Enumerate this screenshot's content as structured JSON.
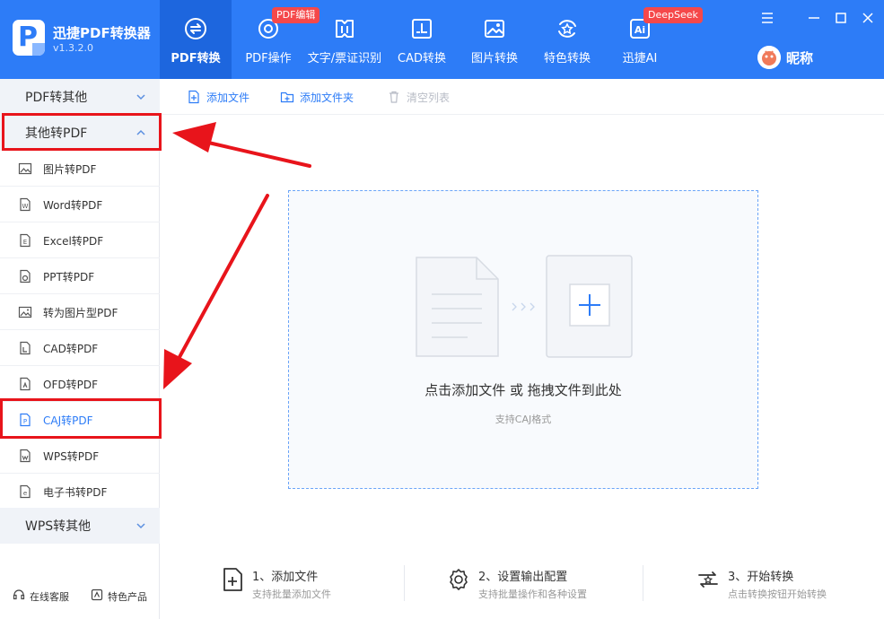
{
  "app": {
    "name": "迅捷PDF转换器",
    "version": "v1.3.2.0"
  },
  "nav_tabs": [
    {
      "label": "PDF转换",
      "active": true,
      "icon": "convert-icon"
    },
    {
      "label": "PDF操作",
      "icon": "gear-doc-icon",
      "badge": "PDF编辑"
    },
    {
      "label": "文字/票证识别",
      "icon": "scan-text-icon"
    },
    {
      "label": "CAD转换",
      "icon": "cad-icon"
    },
    {
      "label": "图片转换",
      "icon": "image-icon"
    },
    {
      "label": "特色转换",
      "icon": "star-convert-icon"
    },
    {
      "label": "迅捷AI",
      "icon": "ai-icon",
      "badge": "DeepSeek"
    }
  ],
  "user": {
    "nickname": "昵称"
  },
  "sidebar": {
    "groups": {
      "pdf_to_other": "PDF转其他",
      "other_to_pdf": "其他转PDF",
      "wps_to_other": "WPS转其他"
    },
    "items": [
      {
        "label": "图片转PDF",
        "icon": "image-icon"
      },
      {
        "label": "Word转PDF",
        "icon": "word-icon"
      },
      {
        "label": "Excel转PDF",
        "icon": "excel-icon"
      },
      {
        "label": "PPT转PDF",
        "icon": "ppt-icon"
      },
      {
        "label": "转为图片型PDF",
        "icon": "image-pdf-icon"
      },
      {
        "label": "CAD转PDF",
        "icon": "cad-icon"
      },
      {
        "label": "OFD转PDF",
        "icon": "ofd-icon"
      },
      {
        "label": "CAJ转PDF",
        "icon": "caj-icon",
        "active": true
      },
      {
        "label": "WPS转PDF",
        "icon": "wps-icon"
      },
      {
        "label": "电子书转PDF",
        "icon": "ebook-icon"
      }
    ],
    "footer": {
      "service": "在线客服",
      "featured": "特色产品"
    }
  },
  "toolbar": {
    "add_file": "添加文件",
    "add_folder": "添加文件夹",
    "clear_list": "清空列表"
  },
  "dropzone": {
    "main_text": "点击添加文件 或 拖拽文件到此处",
    "sub_text": "支持CAJ格式"
  },
  "steps": [
    {
      "title": "1、添加文件",
      "desc": "支持批量添加文件"
    },
    {
      "title": "2、设置输出配置",
      "desc": "支持批量操作和各种设置"
    },
    {
      "title": "3、开始转换",
      "desc": "点击转换按钮开始转换"
    }
  ],
  "colors": {
    "primary": "#2d7cf7",
    "active_tab": "#1d66de",
    "badge": "#f5484a",
    "annotation_red": "#e8141b"
  }
}
